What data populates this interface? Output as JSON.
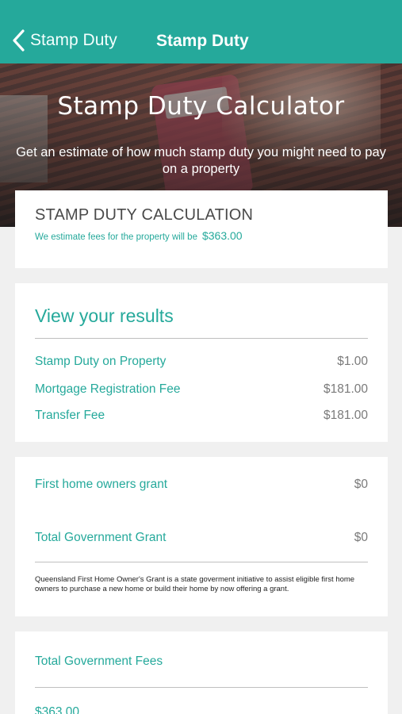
{
  "nav": {
    "back_label": "Stamp Duty",
    "title": "Stamp Duty"
  },
  "hero": {
    "title": "Stamp Duty Calculator",
    "subtitle": "Get an estimate of how much stamp duty you might need to pay on a property"
  },
  "calculation": {
    "heading": "STAMP DUTY CALCULATION",
    "estimate_text": "We estimate fees for the property will be",
    "estimate_amount": "$363.00"
  },
  "results": {
    "heading": "View your results",
    "rows": [
      {
        "label": "Stamp Duty on Property",
        "value": "$1.00"
      },
      {
        "label": "Mortgage Registration Fee",
        "value": "$181.00"
      },
      {
        "label": "Transfer Fee",
        "value": "$181.00"
      }
    ]
  },
  "grants": {
    "rows": [
      {
        "label": "First home owners grant",
        "value": "$0"
      },
      {
        "label": "Total Government Grant",
        "value": "$0"
      }
    ],
    "note": "Queensland First Home Owner's Grant is a state goverment initiative to assist eligible first home owners to purchase a new home or build their home by now offering a grant."
  },
  "fees": {
    "label": "Total Government Fees",
    "value": "$363.00"
  },
  "colors": {
    "accent": "#25a99b",
    "background": "#f0f0f0"
  },
  "icons": {
    "back": "chevron-left-icon"
  }
}
